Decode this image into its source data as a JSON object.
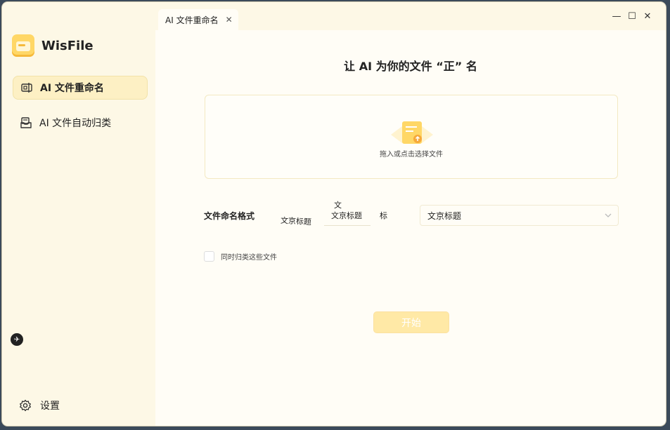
{
  "app": {
    "name": "WisFile"
  },
  "sidebar": {
    "items": [
      {
        "label": "AI 文件重命名",
        "icon": "rename-icon",
        "active": true
      },
      {
        "label": "AI 文件自动归类",
        "icon": "inbox-icon",
        "active": false
      }
    ],
    "settings_label": "设置"
  },
  "tabbar": {
    "tabs": [
      {
        "label": "AI 文件重命名"
      }
    ]
  },
  "window_controls": {
    "minimize": "—",
    "maximize": "☐",
    "close": "✕"
  },
  "main": {
    "title": "让 AI 为你的文件 “正” 名",
    "dropzone": {
      "text": "拖入或点击选择文件",
      "icon": "upload-file-icon"
    },
    "format": {
      "label": "文件命名格式",
      "chip_left": "文京标题",
      "input_top": "文",
      "input_value": "文京标题",
      "chip_right": "标",
      "select_value": "文京标题"
    },
    "also_classify_label": "同时归类这些文件",
    "start_label": "开始"
  },
  "colors": {
    "accent": "#ffd766",
    "sidebar_bg": "#fdf8e6",
    "start_button": "#ffe9a6"
  }
}
